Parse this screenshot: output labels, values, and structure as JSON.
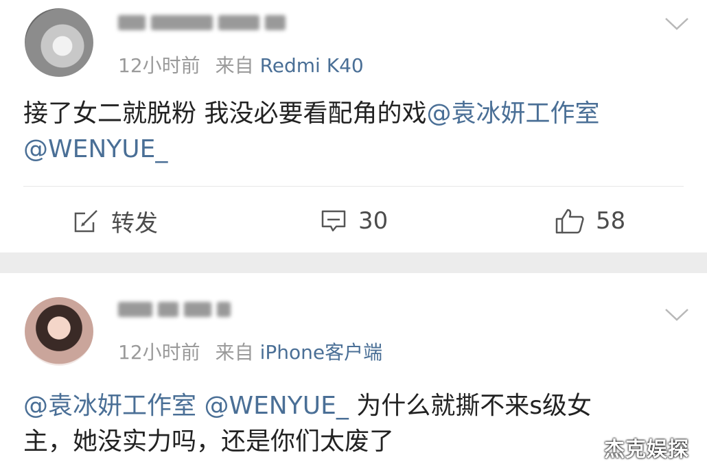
{
  "posts": [
    {
      "time": "12小时前",
      "from_label": "来自",
      "source": "Redmi K40",
      "content_text": "接了女二就脱粉 我没必要看配角的戏",
      "mention_1": "@袁冰妍工作室",
      "mention_2": "@WENYUE_",
      "actions": {
        "repost_label": "转发",
        "comment_count": "30",
        "like_count": "58"
      }
    },
    {
      "time": "12小时前",
      "from_label": "来自",
      "source": "iPhone客户端",
      "mention_1": "@袁冰妍工作室",
      "mention_2": "@WENYUE_",
      "content_text_line1": "为什么就撕不来s级女",
      "content_text_line2": "主，她没实力吗，还是你们太废了"
    }
  ],
  "watermark": "杰克娱探",
  "icons": {
    "avatar": "avatar-image",
    "expand": "chevron-down-icon",
    "repost": "repost-icon",
    "comment": "comment-icon",
    "like": "thumbs-up-icon"
  },
  "colors": {
    "link": "#4a6f96",
    "meta": "#9a9a9a",
    "separator_band": "#ececec"
  }
}
